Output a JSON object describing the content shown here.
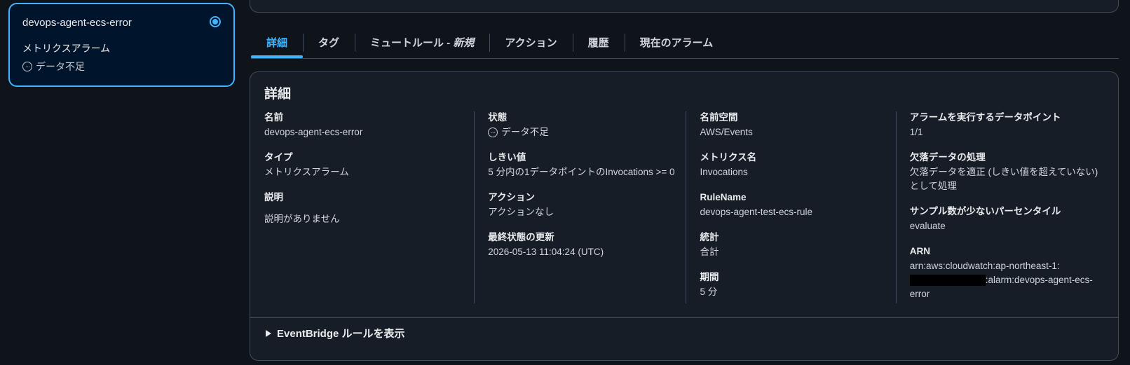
{
  "alarm_card": {
    "name": "devops-agent-ecs-error",
    "type": "メトリクスアラーム",
    "state": "データ不足"
  },
  "tabs": [
    {
      "label": "詳細",
      "active": true
    },
    {
      "label": "タグ"
    },
    {
      "label": "ミュートルール - ",
      "suffix": "新規"
    },
    {
      "label": "アクション"
    },
    {
      "label": "履歴"
    },
    {
      "label": "現在のアラーム"
    }
  ],
  "details": {
    "title": "詳細",
    "col1": {
      "name_label": "名前",
      "name_value": "devops-agent-ecs-error",
      "type_label": "タイプ",
      "type_value": "メトリクスアラーム",
      "desc_label": "説明",
      "desc_value": "説明がありません"
    },
    "col2": {
      "state_label": "状態",
      "state_value": "データ不足",
      "threshold_label": "しきい値",
      "threshold_value": "5 分内の1データポイントのInvocations >= 0",
      "actions_label": "アクション",
      "actions_value": "アクションなし",
      "updated_label": "最終状態の更新",
      "updated_value": "2026-05-13 11:04:24 (UTC)"
    },
    "col3": {
      "namespace_label": "名前空間",
      "namespace_value": "AWS/Events",
      "metric_label": "メトリクス名",
      "metric_value": "Invocations",
      "rule_label": "RuleName",
      "rule_value": "devops-agent-test-ecs-rule",
      "stat_label": "統計",
      "stat_value": "合計",
      "period_label": "期間",
      "period_value": "5 分"
    },
    "col4": {
      "datapoints_label": "アラームを実行するデータポイント",
      "datapoints_value": "1/1",
      "missing_label": "欠落データの処理",
      "missing_value": "欠落データを適正 (しきい値を超えていない)として処理",
      "percentile_label": "サンプル数が少ないパーセンタイル",
      "percentile_value": "evaluate",
      "arn_label": "ARN",
      "arn_part1": "arn:aws:cloudwatch:ap-northeast-1:",
      "arn_part2": ":alarm:devops-agent-ecs-error"
    },
    "expander_label": "EventBridge ルールを表示"
  }
}
